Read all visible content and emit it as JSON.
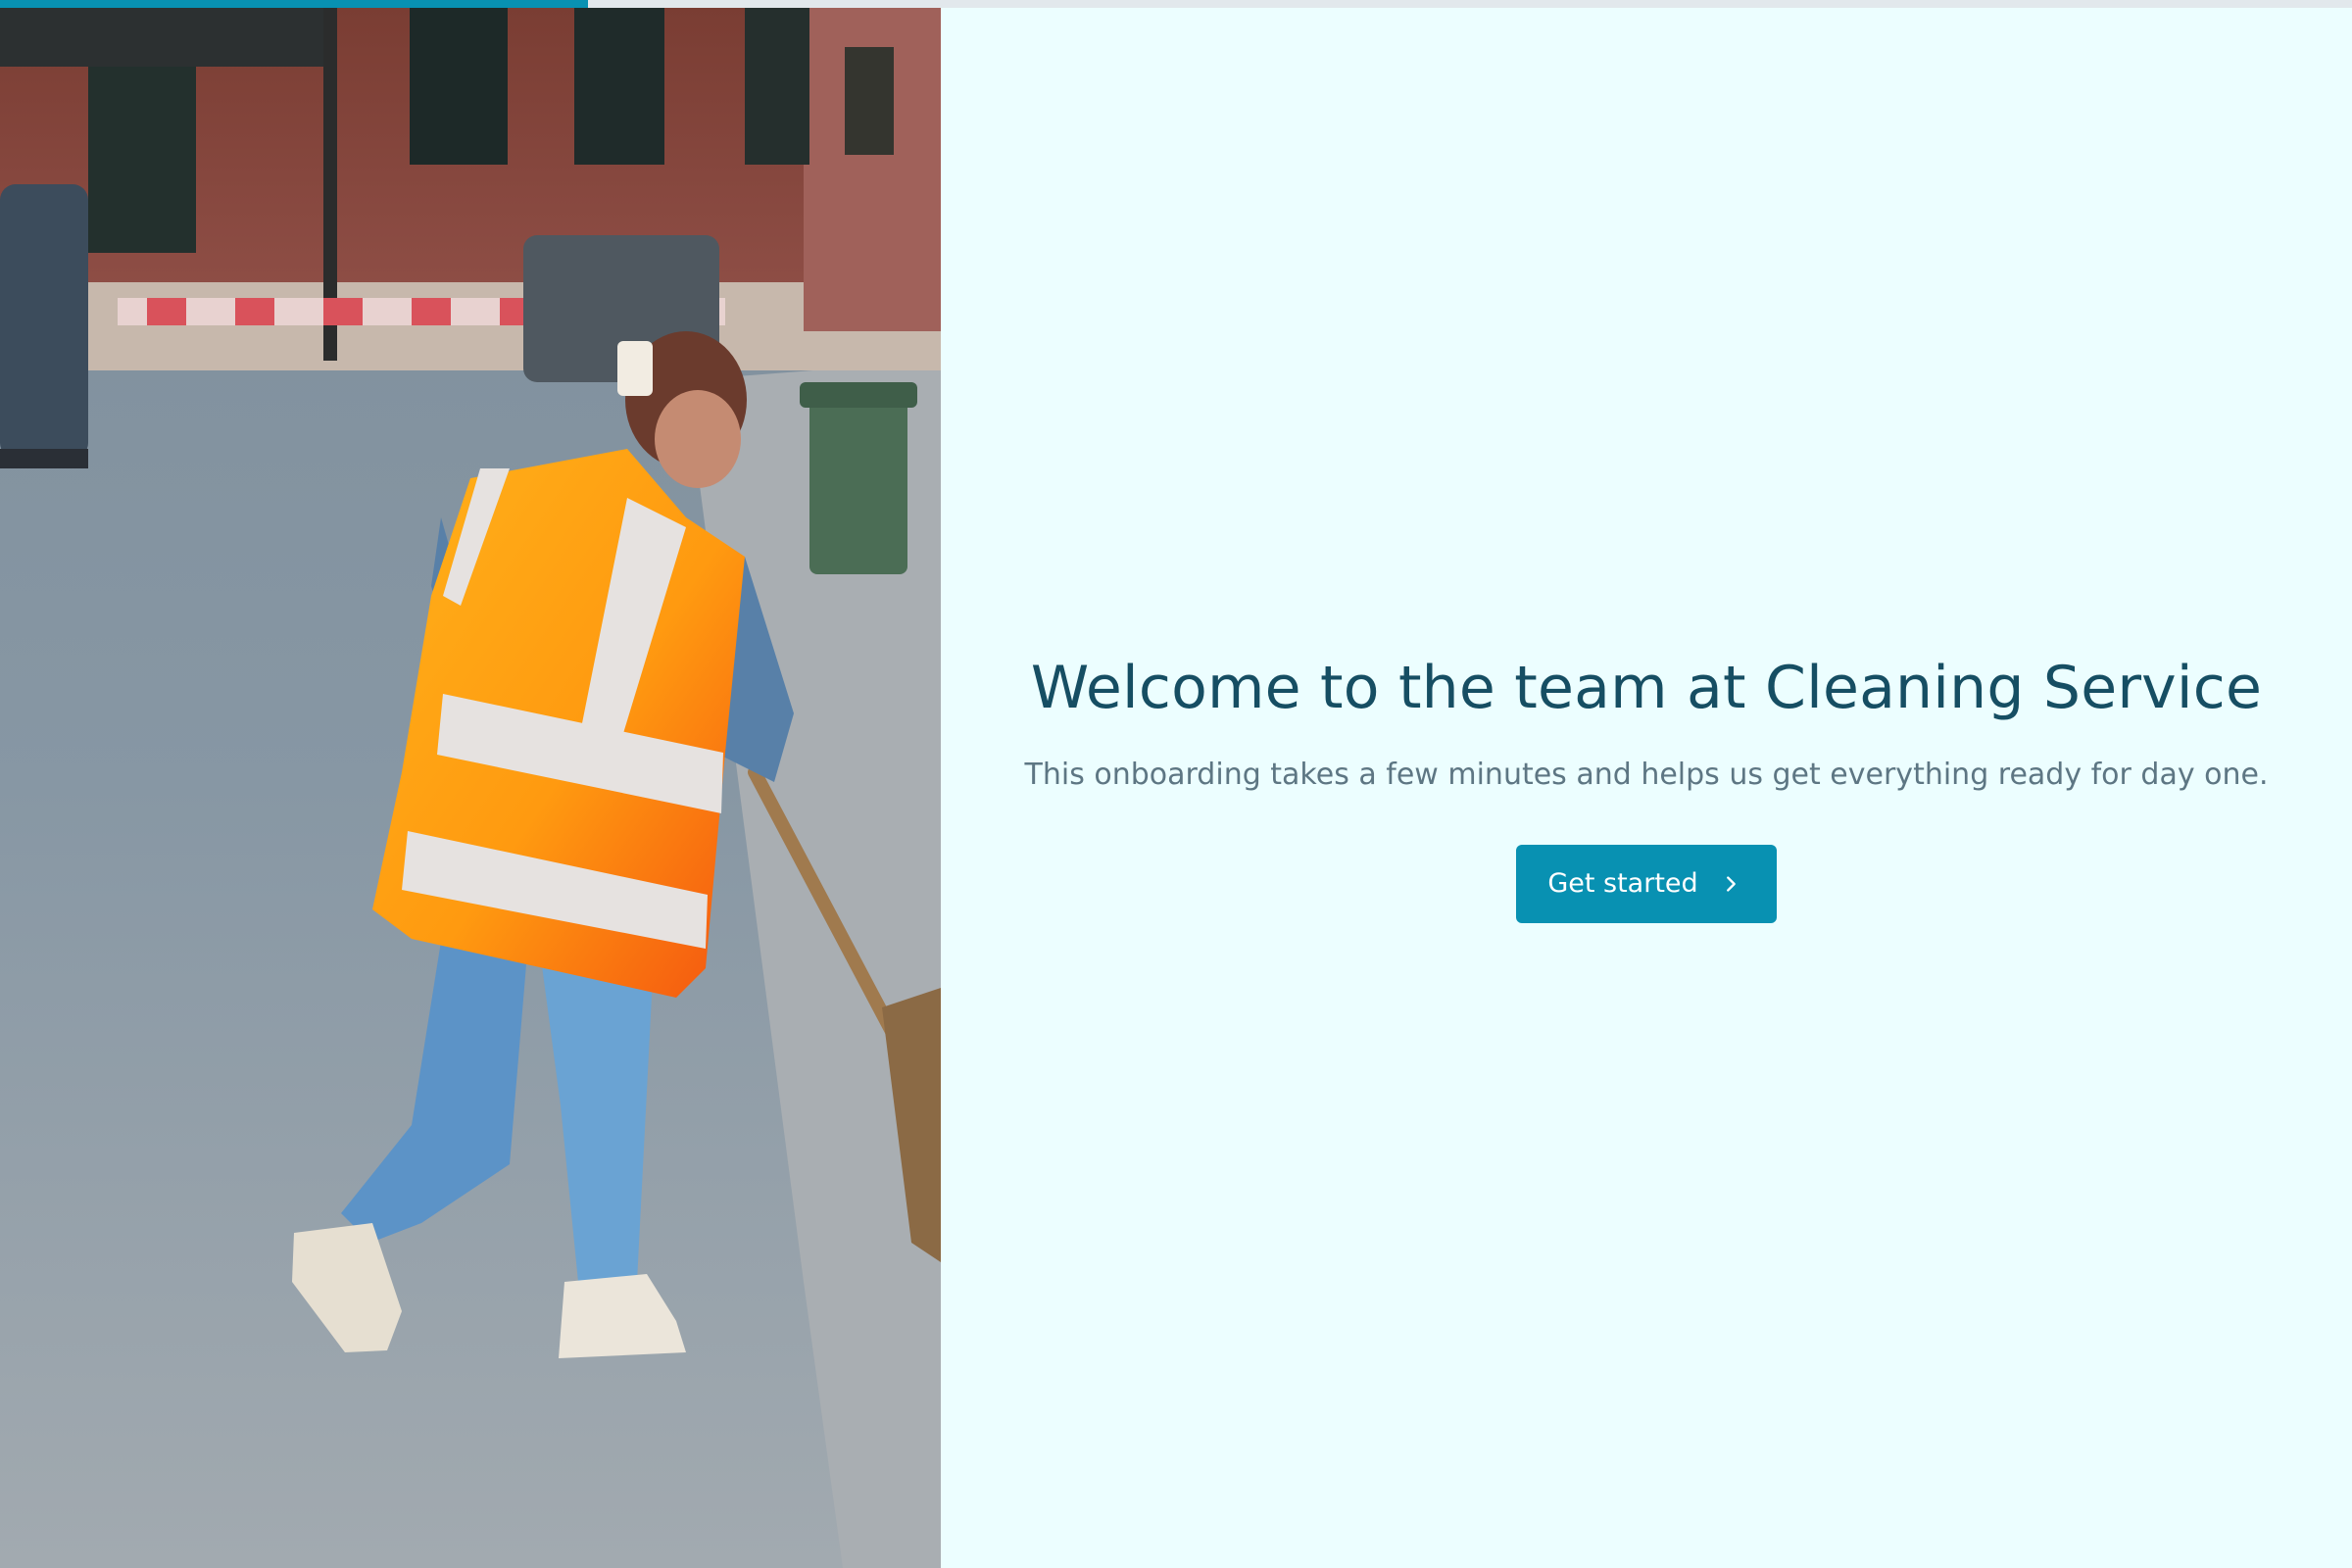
{
  "progress": {
    "fraction": 0.25,
    "color": "#0891b2",
    "track_color": "#e2e8ec"
  },
  "hero": {
    "subject": "street cleaner in orange high-visibility vest sweeping with a broom",
    "vest_print": ""
  },
  "welcome": {
    "title": "Welcome to the team at Cleaning Service",
    "subtitle": "This onboarding takes a few minutes and helps us get everything ready for day one.",
    "cta_label": "Get started",
    "cta_icon": "chevron-right-icon"
  },
  "colors": {
    "background": "#ecfeff",
    "title": "#164e63",
    "subtitle": "#5d7683",
    "accent": "#0891b2"
  }
}
